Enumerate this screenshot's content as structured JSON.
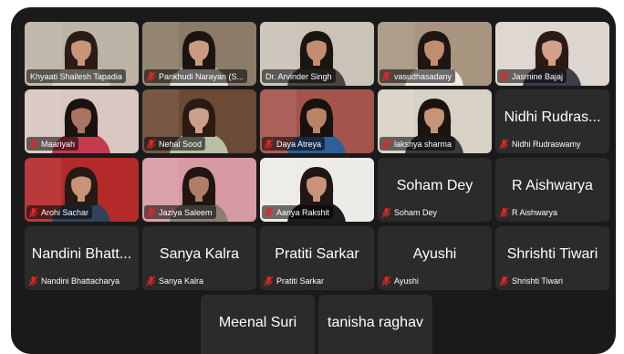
{
  "colors": {
    "window_bg": "#1a1a1a",
    "tile_bg": "#2b2b2b",
    "active_border": "#2ecc40",
    "muted_icon": "#e02828"
  },
  "participants": [
    {
      "name": "Khyaati Shailesh Tapadia",
      "video": true,
      "muted": false,
      "wall": "#bdb3a6",
      "skin": "#c8957a",
      "hair": "#2a1c16",
      "shirt": "#d9d2c8"
    },
    {
      "name": "Pankhudi Narayan (S...",
      "video": true,
      "muted": true,
      "wall": "#8b7b68",
      "skin": "#c99a80",
      "hair": "#1d1411",
      "shirt": "#e6e2dc"
    },
    {
      "name": "Dr. Arvinder Singh",
      "video": true,
      "muted": false,
      "active": true,
      "wall": "#c9c3b8",
      "skin": "#c48c70",
      "hair": "#1b1512",
      "shirt": "#4a4542"
    },
    {
      "name": "vasudhasadany",
      "video": true,
      "muted": true,
      "wall": "#a89580",
      "skin": "#c08d72",
      "hair": "#1e1613",
      "shirt": "#f0ede8"
    },
    {
      "name": "Jasmine Bajaj",
      "video": true,
      "muted": true,
      "wall": "#ddd5cf",
      "skin": "#d3a08a",
      "hair": "#2b1b15",
      "shirt": "#3a3f4a"
    },
    {
      "name": "Maariyah",
      "video": true,
      "muted": true,
      "wall": "#d9c7c1",
      "skin": "#a97560",
      "hair": "#1a1210",
      "shirt": "#c63a4e"
    },
    {
      "name": "Nehal Sood",
      "video": true,
      "muted": true,
      "wall": "#6b4a36",
      "skin": "#caa08a",
      "hair": "#2a1a12",
      "shirt": "#b8c1a3"
    },
    {
      "name": "Daya Atreya",
      "video": true,
      "muted": true,
      "wall": "#a4544c",
      "skin": "#b98368",
      "hair": "#17110f",
      "shirt": "#2f5f9a"
    },
    {
      "name": "lakshya sharma",
      "video": true,
      "muted": true,
      "wall": "#d8d2c6",
      "skin": "#c89478",
      "hair": "#1a1411",
      "shirt": "#3a3a3a"
    },
    {
      "name": "Nidhi Rudras...",
      "label": "Nidhi Rudraswamy",
      "video": false,
      "muted": true
    },
    {
      "name": "Arohi Sachar",
      "video": true,
      "muted": true,
      "wall": "#b42a2a",
      "skin": "#c99378",
      "hair": "#261a14",
      "shirt": "#31435a"
    },
    {
      "name": "Jaziya Saleem",
      "video": true,
      "muted": true,
      "wall": "#d79aa2",
      "skin": "#b07d66",
      "hair": "#1f1512",
      "shirt": "#8a7f76"
    },
    {
      "name": "Aanya Rakshit",
      "video": true,
      "muted": true,
      "wall": "#ecebe7",
      "skin": "#c8937a",
      "hair": "#201613",
      "shirt": "#1d1d1d"
    },
    {
      "name": "Soham Dey",
      "label": "Soham Dey",
      "video": false,
      "muted": true
    },
    {
      "name": "R Aishwarya",
      "label": "R Aishwarya",
      "video": false,
      "muted": true
    },
    {
      "name": "Nandini Bhatt...",
      "label": "Nandini Bhattacharya",
      "video": false,
      "muted": true
    },
    {
      "name": "Sanya Kalra",
      "label": "Sanya Kalra",
      "video": false,
      "muted": true
    },
    {
      "name": "Pratiti Sarkar",
      "label": "Pratiti Sarkar",
      "video": false,
      "muted": true
    },
    {
      "name": "Ayushi",
      "label": "Ayushi",
      "video": false,
      "muted": true
    },
    {
      "name": "Shrishti Tiwari",
      "label": "Shrishti Tiwari",
      "video": false,
      "muted": true
    },
    {
      "name": "Meenal Suri",
      "label": "",
      "video": false,
      "muted": false
    },
    {
      "name": "tanisha raghav",
      "label": "",
      "video": false,
      "muted": false
    }
  ]
}
